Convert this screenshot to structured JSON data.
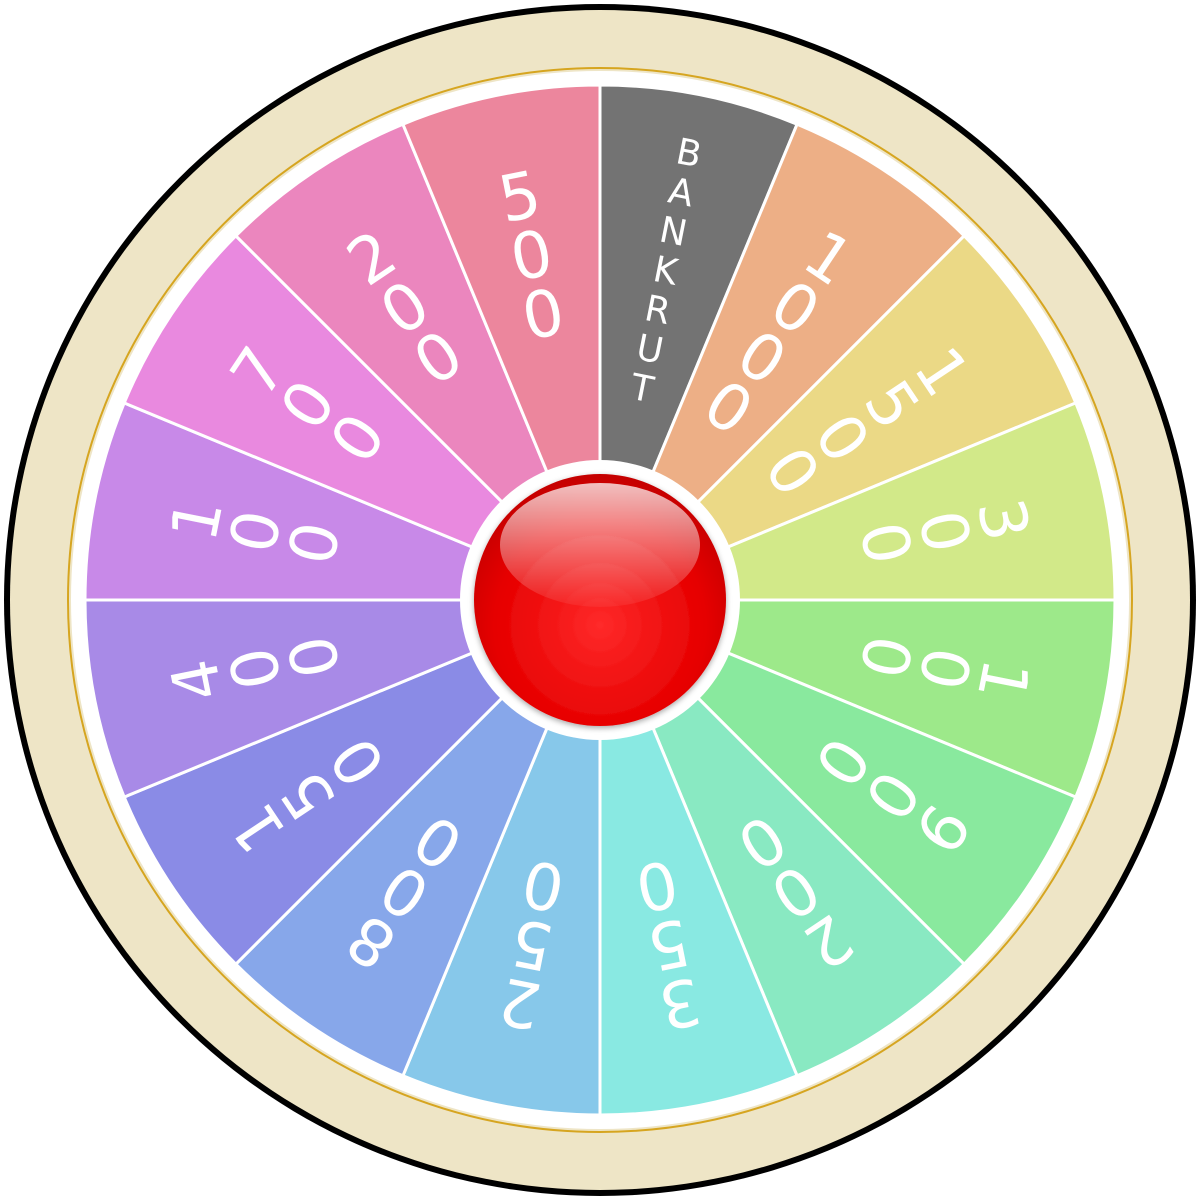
{
  "wheel": {
    "frame_color": "#EEE5C6",
    "rim_color": "#000000",
    "gold_ring_color": "#D6A520",
    "divider_color": "#ffffff",
    "label_color": "#ffffff",
    "segments": [
      {
        "label": "BANKRUT",
        "color": "#737373"
      },
      {
        "label": "1000",
        "color": "#EDAF86"
      },
      {
        "label": "1500",
        "color": "#EBD986"
      },
      {
        "label": "300",
        "color": "#D2E989"
      },
      {
        "label": "100",
        "color": "#9DE98A"
      },
      {
        "label": "900",
        "color": "#89E99E"
      },
      {
        "label": "200",
        "color": "#89E9C2"
      },
      {
        "label": "350",
        "color": "#89E9E2"
      },
      {
        "label": "250",
        "color": "#87C8EA"
      },
      {
        "label": "800",
        "color": "#87A7EA"
      },
      {
        "label": "150",
        "color": "#8A8BE6"
      },
      {
        "label": "400",
        "color": "#A88AE7"
      },
      {
        "label": "100",
        "color": "#C889E8"
      },
      {
        "label": "700",
        "color": "#E989DF"
      },
      {
        "label": "200",
        "color": "#EB86BE"
      },
      {
        "label": "500",
        "color": "#EC869D"
      }
    ]
  },
  "spin_button": {
    "color": "#E80000",
    "ring_color": "#ffffff"
  }
}
